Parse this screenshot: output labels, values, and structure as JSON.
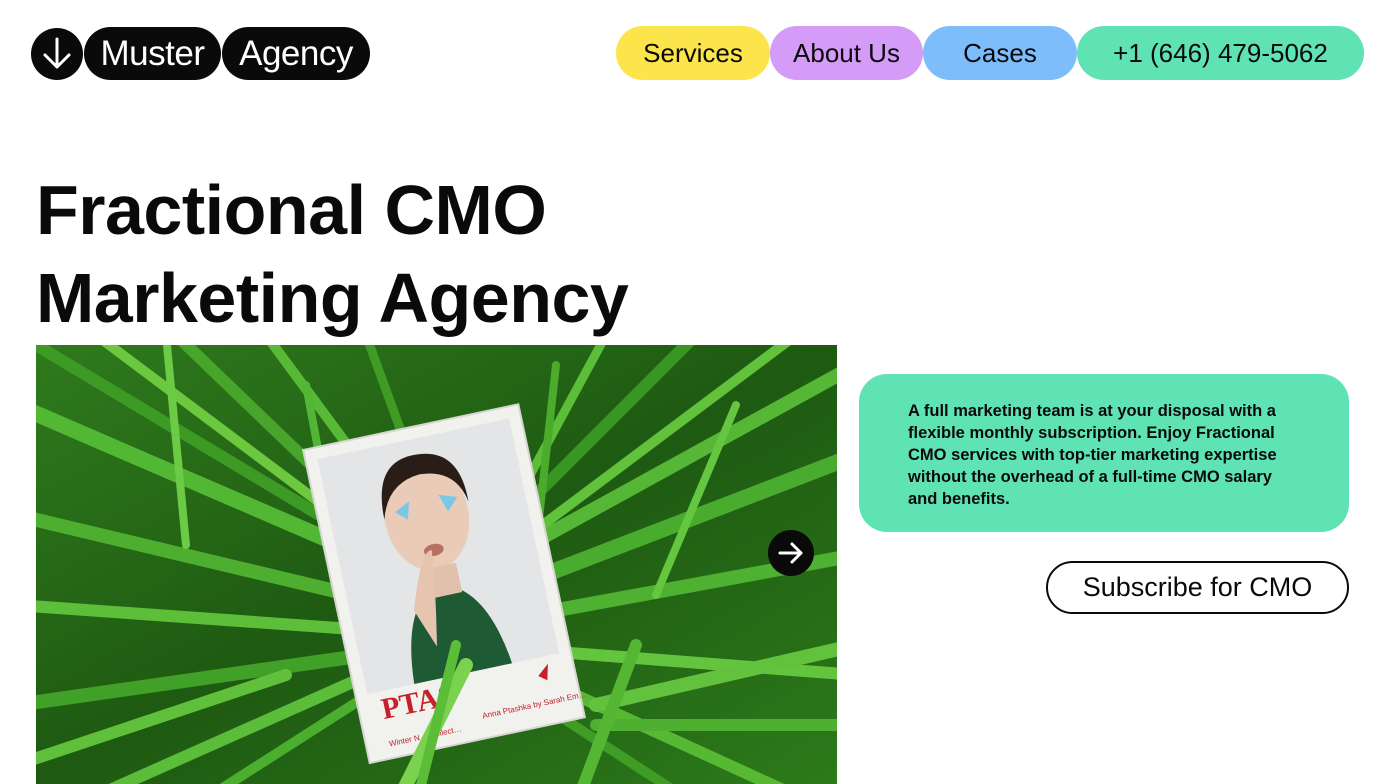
{
  "logo": {
    "icon": "arrow-down-icon",
    "word1": "Muster",
    "word2": "Agency"
  },
  "nav": {
    "services": "Services",
    "about": "About Us",
    "cases": "Cases",
    "phone": "+1 (646) 479-5062"
  },
  "colors": {
    "services": "#fbe54a",
    "about": "#d49cf6",
    "cases": "#7dbdfb",
    "accent_green": "#5fe3b4",
    "dark": "#0a0a0a"
  },
  "hero": {
    "title_line1": "Fractional CMO",
    "title_line2": "Marketing Agency",
    "photo": {
      "magazine_title": "PTAS",
      "magazine_caption_left": "Winter N… Collect…",
      "magazine_caption_right": "Anna Ptashka by Sarah Em…"
    },
    "next_icon": "arrow-right-icon"
  },
  "info": {
    "text": "A full marketing team is at your disposal with a flexible monthly subscription. Enjoy Fractional CMO services with top-tier marketing expertise without the overhead of a full-time CMO salary and benefits."
  },
  "cta": {
    "subscribe": "Subscribe for CMO"
  }
}
